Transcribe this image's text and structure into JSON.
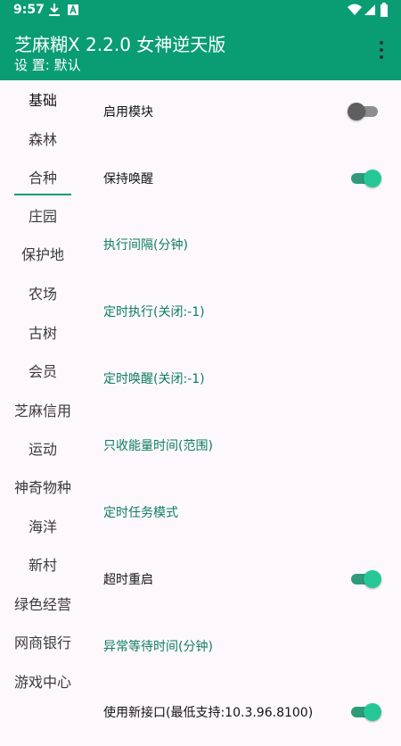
{
  "status_bar": {
    "time": "9:57",
    "icons": [
      "download-icon",
      "font-app-icon",
      "wifi-icon",
      "signal-icon",
      "battery-icon"
    ]
  },
  "app_bar": {
    "title": "芝麻糊X 2.2.0 女神逆天版",
    "subtitle": "设 置: 默认",
    "menu_icon": "more-vert-icon"
  },
  "sidebar": {
    "items": [
      {
        "label": "基础",
        "active": true
      },
      {
        "label": "森林"
      },
      {
        "label": "合种"
      },
      {
        "label": "庄园"
      },
      {
        "label": "保护地"
      },
      {
        "label": "农场"
      },
      {
        "label": "古树"
      },
      {
        "label": "会员"
      },
      {
        "label": "芝麻信用"
      },
      {
        "label": "运动"
      },
      {
        "label": "神奇物种"
      },
      {
        "label": "海洋"
      },
      {
        "label": "新村"
      },
      {
        "label": "绿色经营"
      },
      {
        "label": "网商银行"
      },
      {
        "label": "游戏中心"
      }
    ]
  },
  "settings": {
    "rows": [
      {
        "label": "启用模块",
        "type": "switch",
        "checked": false
      },
      {
        "label": "保持唤醒",
        "type": "switch",
        "checked": true
      },
      {
        "label": "执行间隔(分钟)",
        "type": "link"
      },
      {
        "label": "定时执行(关闭:-1)",
        "type": "link"
      },
      {
        "label": "定时唤醒(关闭:-1)",
        "type": "link"
      },
      {
        "label": "只收能量时间(范围)",
        "type": "link"
      },
      {
        "label": "定时任务模式",
        "type": "link"
      },
      {
        "label": "超时重启",
        "type": "switch",
        "checked": true
      },
      {
        "label": "异常等待时间(分钟)",
        "type": "link"
      },
      {
        "label": "使用新接口(最低支持:10.3.96.8100)",
        "type": "switch",
        "checked": true
      }
    ]
  },
  "colors": {
    "primary": "#0a9d73",
    "link_text": "#0e7d61",
    "switch_on": "#26c797",
    "background": "#fcf8fc"
  }
}
